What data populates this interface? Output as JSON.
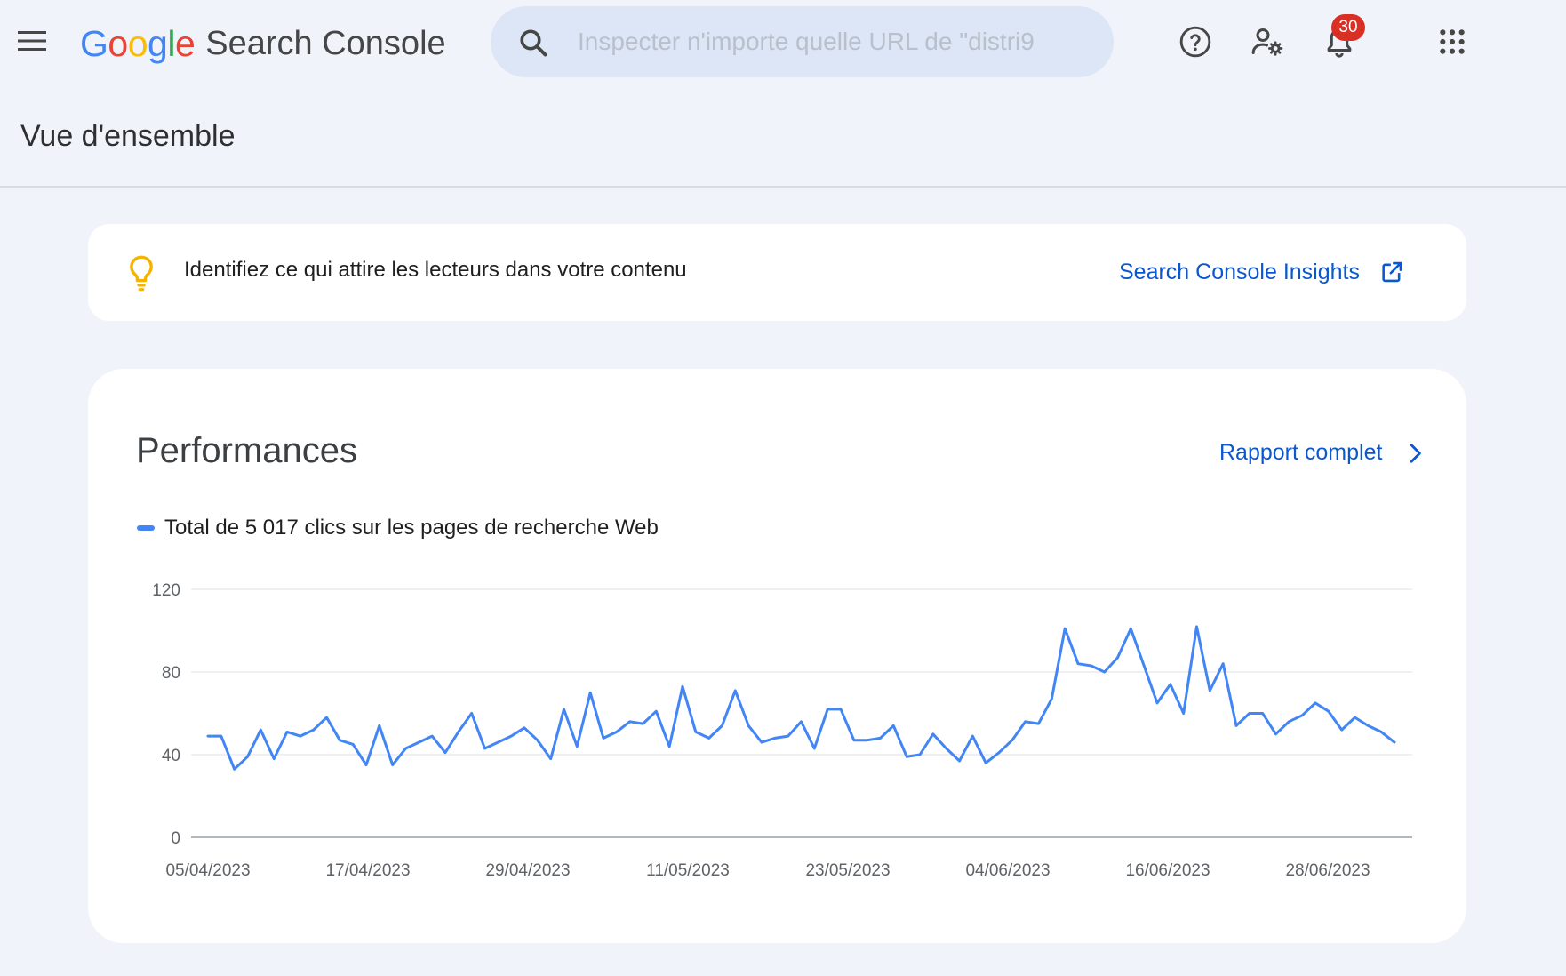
{
  "header": {
    "logo_google": "Google",
    "logo_product": "Search Console",
    "search_placeholder": "Inspecter n'importe quelle URL de \"distri9",
    "notification_count": "30",
    "icons": [
      "menu-icon",
      "search-icon",
      "help-icon",
      "manage-users-icon",
      "notifications-icon",
      "apps-grid-icon"
    ]
  },
  "page": {
    "title": "Vue d'ensemble"
  },
  "insight_card": {
    "icon": "lightbulb-icon",
    "text": "Identifiez ce qui attire les lecteurs dans votre contenu",
    "link_label": "Search Console Insights",
    "link_icon": "open-in-new-icon"
  },
  "performance_card": {
    "title": "Performances",
    "report_link_label": "Rapport complet",
    "report_link_icon": "chevron-right-icon"
  },
  "colors": {
    "accent": "#0b57d0",
    "series": "#4285f4",
    "background": "#f0f4fa",
    "badge": "#d93025"
  },
  "chart_data": {
    "type": "line",
    "legend": "Total de 5 017 clics sur les pages de recherche Web",
    "x_start": "05/04/2023",
    "x_end": "03/07/2023",
    "x_tick_labels": [
      "05/04/2023",
      "17/04/2023",
      "29/04/2023",
      "11/05/2023",
      "23/05/2023",
      "04/06/2023",
      "16/06/2023",
      "28/06/2023"
    ],
    "y_ticks": [
      0,
      40,
      80,
      120
    ],
    "ylim": [
      0,
      120
    ],
    "grid": true,
    "series": [
      {
        "name": "Total de 5 017 clics sur les pages de recherche Web",
        "color": "#4285f4",
        "values": [
          49,
          49,
          33,
          39,
          52,
          38,
          51,
          49,
          52,
          58,
          47,
          45,
          35,
          54,
          35,
          43,
          46,
          49,
          41,
          51,
          60,
          43,
          46,
          49,
          53,
          47,
          38,
          62,
          44,
          70,
          48,
          51,
          56,
          55,
          61,
          44,
          73,
          51,
          48,
          54,
          71,
          54,
          46,
          48,
          49,
          56,
          43,
          62,
          62,
          47,
          47,
          48,
          54,
          39,
          40,
          50,
          43,
          37,
          49,
          36,
          41,
          47,
          56,
          55,
          67,
          101,
          84,
          83,
          80,
          87,
          101,
          83,
          65,
          74,
          60,
          102,
          71,
          84,
          54,
          60,
          60,
          50,
          56,
          59,
          65,
          61,
          52,
          58,
          54,
          51,
          46
        ]
      }
    ]
  }
}
